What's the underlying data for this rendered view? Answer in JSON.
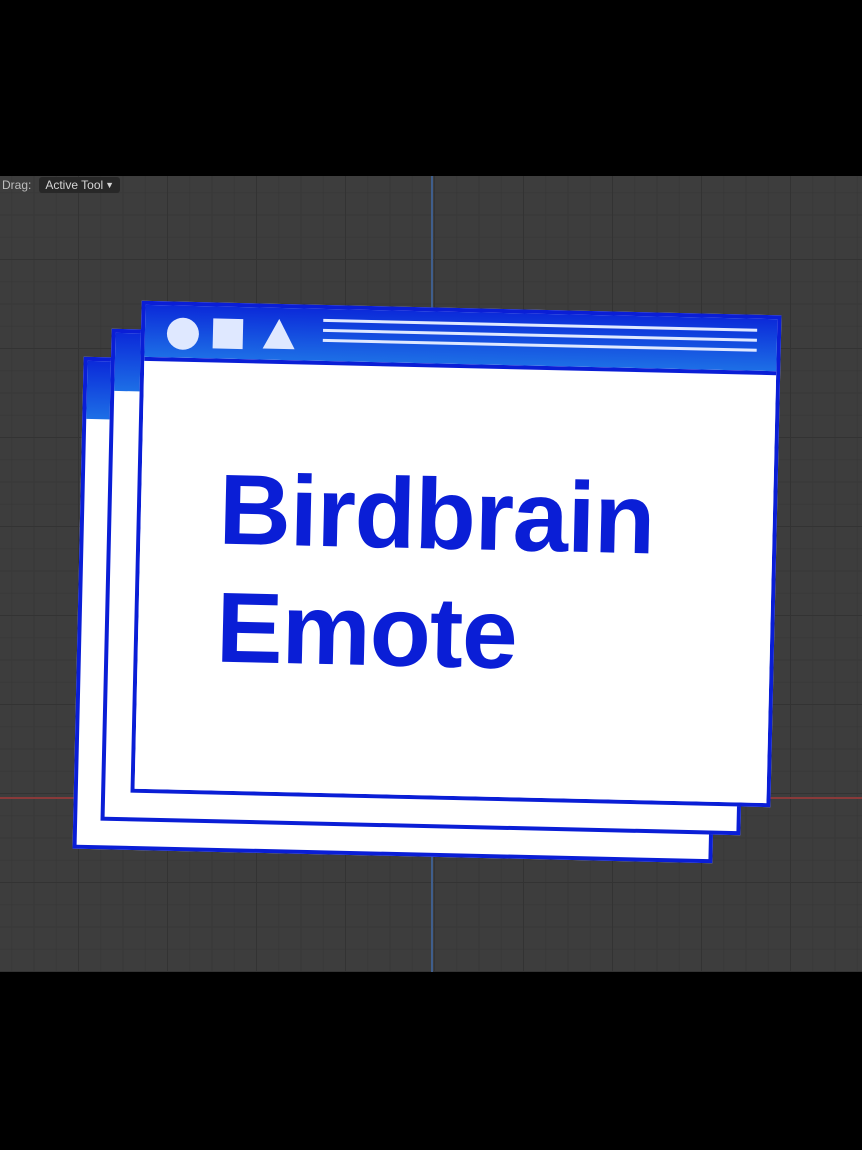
{
  "toolbar": {
    "drag_label": "Drag:",
    "tool_dropdown_value": "Active Tool",
    "dropdown_icon": "chevron-down-icon"
  },
  "window": {
    "titlebar_icons": [
      "circle-icon",
      "square-icon",
      "triangle-icon"
    ],
    "headline_line1": "Birdbrain",
    "headline_line2": "Emote"
  },
  "colors": {
    "accent_blue": "#0a1ed6",
    "titlebar_gradient_top": "#0b2ad9",
    "titlebar_gradient_bottom": "#1d6fe6",
    "viewport_bg": "#3d3d3d",
    "axis_y": "#3f5e8c",
    "axis_x": "#8a3a3a"
  }
}
